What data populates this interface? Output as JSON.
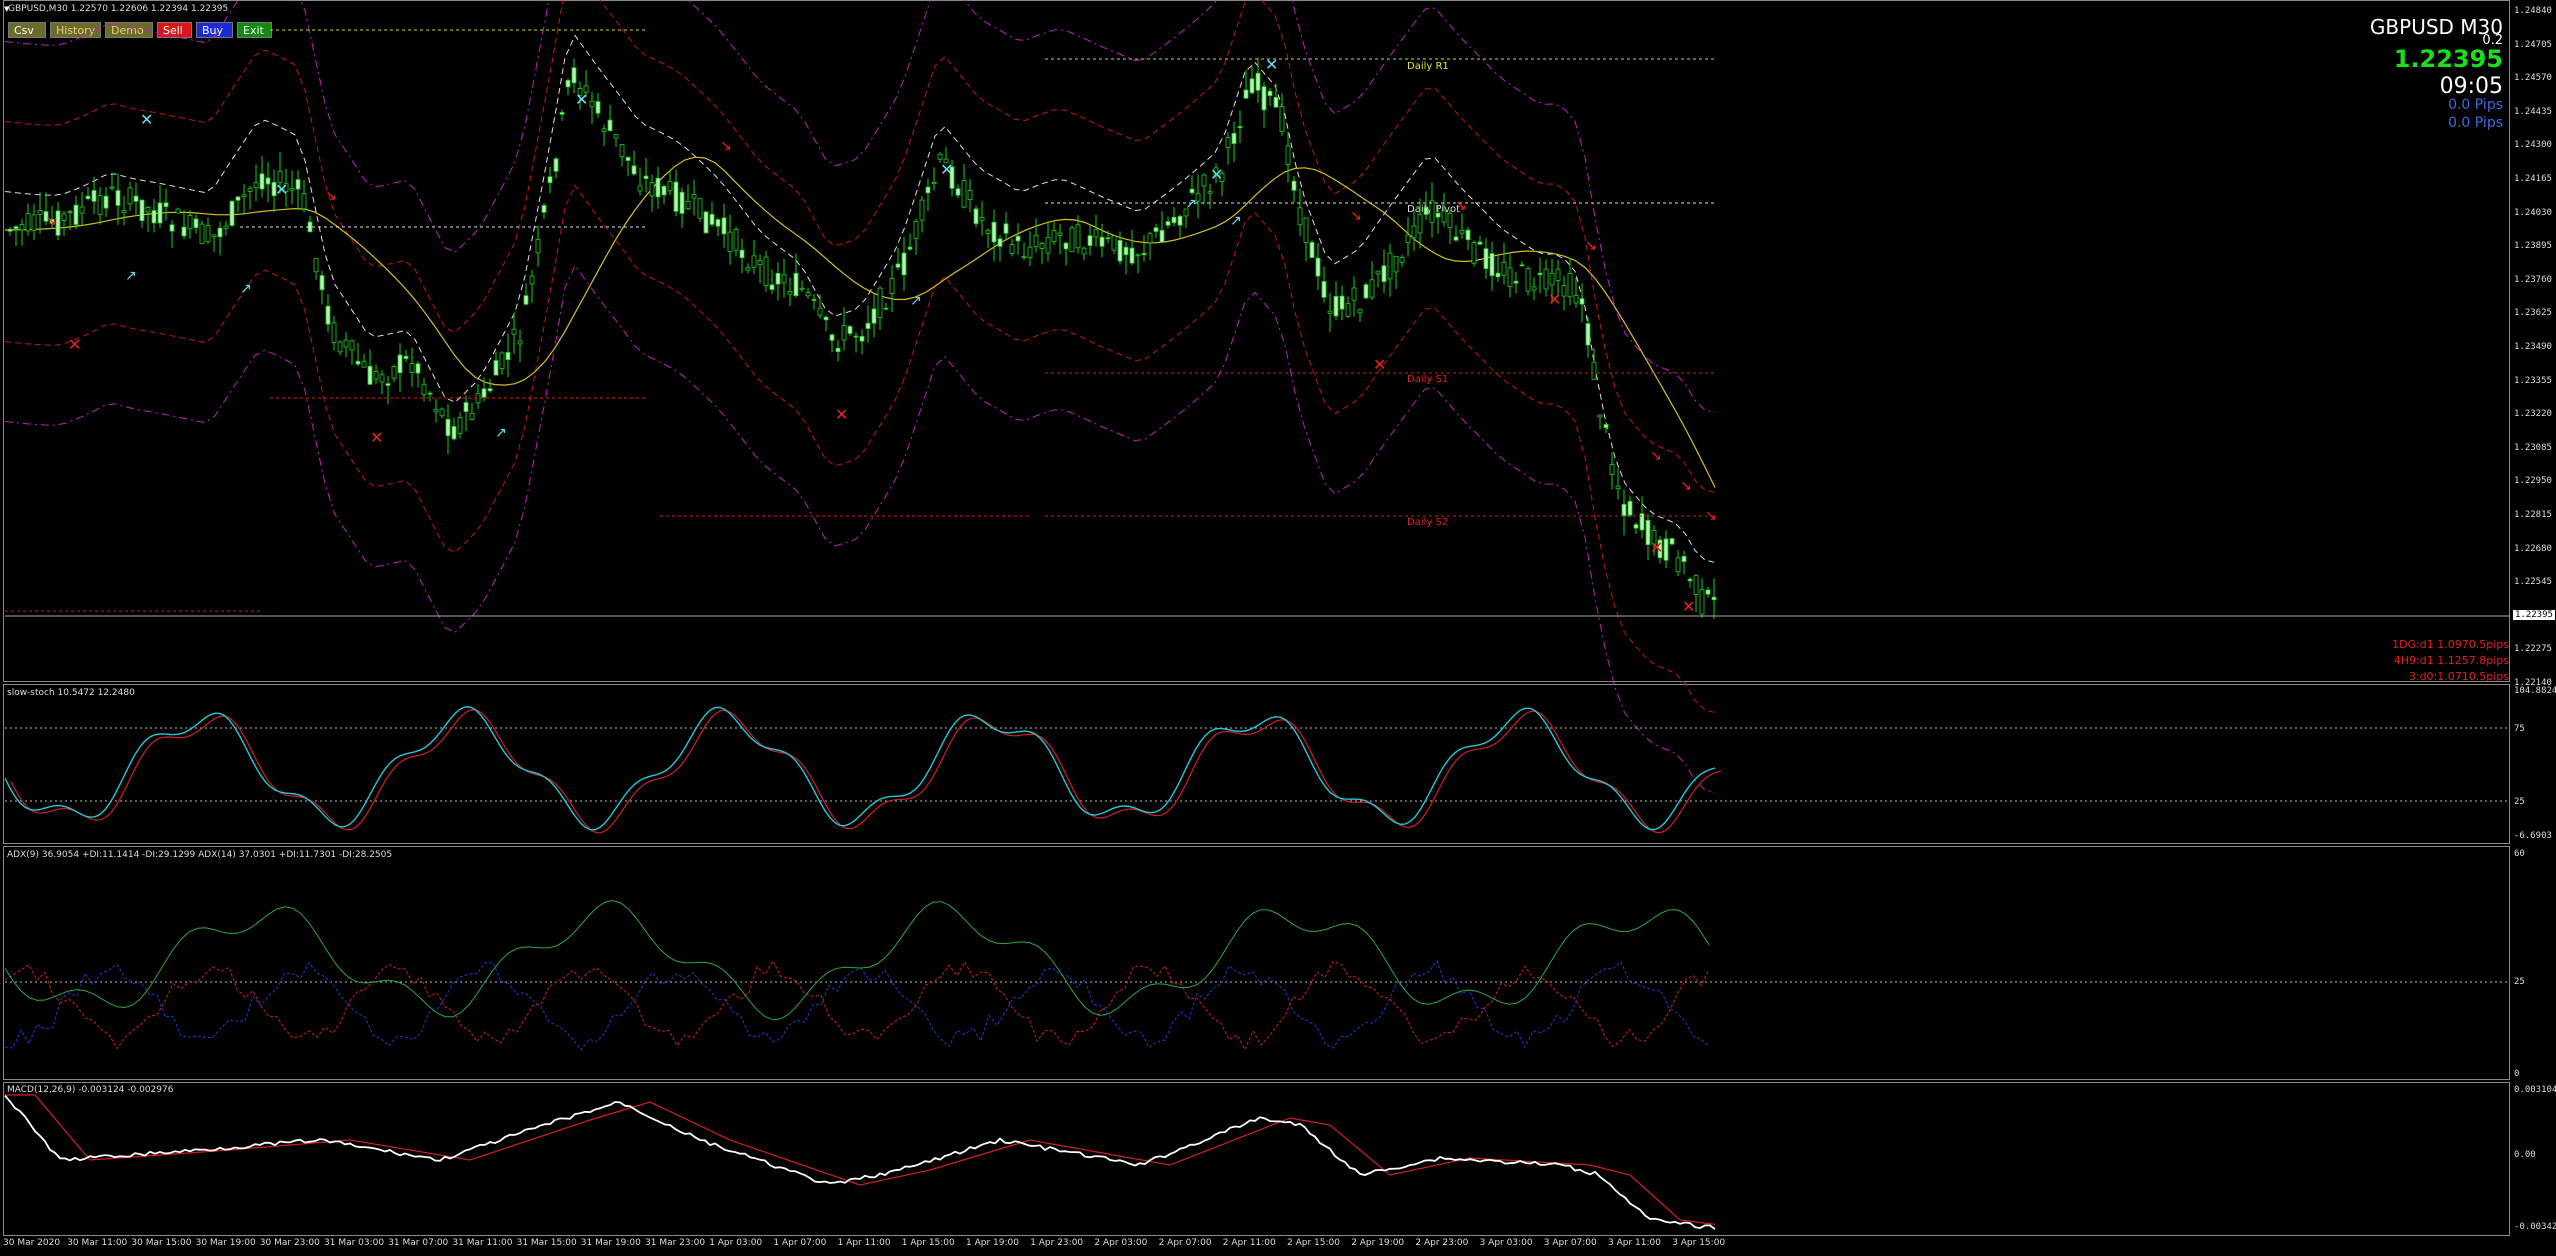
{
  "header": {
    "title": "GBPUSD,M30  1.22570 1.22606 1.22394 1.22395"
  },
  "toolbar": {
    "buttons": [
      {
        "label": "Csv",
        "bg": "#6b6b2a",
        "fg": "#ffffff"
      },
      {
        "label": "History",
        "bg": "#6b6b2a",
        "fg": "#e0d080"
      },
      {
        "label": "Demo",
        "bg": "#6b6b2a",
        "fg": "#e0d080"
      },
      {
        "label": "Sell",
        "bg": "#d81818",
        "fg": "#ffffff"
      },
      {
        "label": "Buy",
        "bg": "#1a2ad8",
        "fg": "#ffffff"
      },
      {
        "label": "Exit",
        "bg": "#128a12",
        "fg": "#ffffff"
      }
    ]
  },
  "hud": {
    "symbol": "GBPUSD M30",
    "spread": "0.2",
    "price": "1.22395",
    "time": "09:05",
    "pips1": "0.0 Pips",
    "pips2": "0.0 Pips",
    "colors": {
      "price": "#19e019",
      "pips": "#3a6adf",
      "symbol": "#ffffff"
    }
  },
  "levels": {
    "daily_r1": "Daily R1",
    "daily_pivot": "Daily Pivot",
    "daily_s1": "Daily S1",
    "daily_s2": "Daily S2"
  },
  "range_stats": [
    "1DG:d1 1.0970.5pips",
    "4H9:d1 1.1257.8pips",
    "3:d0:1.0710.5pips"
  ],
  "price_axis": {
    "ticks": [
      "1.24840",
      "1.24705",
      "1.24570",
      "1.24435",
      "1.24300",
      "1.24165",
      "1.24030",
      "1.23895",
      "1.23760",
      "1.23625",
      "1.23490",
      "1.23355",
      "1.23220",
      "1.23085",
      "1.22950",
      "1.22815",
      "1.22680",
      "1.22545",
      "1.22410",
      "1.22275",
      "1.22140"
    ],
    "current": "1.22395"
  },
  "stoch": {
    "label": "slow-stoch 10.5472 12.2480",
    "ticks": [
      "104.8824",
      "75",
      "25",
      "-6.6903"
    ]
  },
  "adx": {
    "label": "ADX(9) 36.9054 +DI:11.1414 -DI:29.1299  ADX(14) 37.0301 +DI:11.7301 -DI:28.2505",
    "ticks": [
      "60",
      "25",
      "0"
    ]
  },
  "macd": {
    "label": "MACD(12,26,9) -0.003124 -0.002976",
    "ticks": [
      "0.003104",
      "0.00",
      "-0.003421"
    ]
  },
  "time_axis": [
    "30 Mar 2020",
    "30 Mar 11:00",
    "30 Mar 15:00",
    "30 Mar 19:00",
    "30 Mar 23:00",
    "31 Mar 03:00",
    "31 Mar 07:00",
    "31 Mar 11:00",
    "31 Mar 15:00",
    "31 Mar 19:00",
    "31 Mar 23:00",
    "1 Apr 03:00",
    "1 Apr 07:00",
    "1 Apr 11:00",
    "1 Apr 15:00",
    "1 Apr 19:00",
    "1 Apr 23:00",
    "2 Apr 03:00",
    "2 Apr 07:00",
    "2 Apr 11:00",
    "2 Apr 15:00",
    "2 Apr 19:00",
    "2 Apr 23:00",
    "3 Apr 03:00",
    "3 Apr 07:00",
    "3 Apr 11:00",
    "3 Apr 15:00"
  ],
  "icons": [
    "buy-arrow-icon",
    "sell-arrow-icon",
    "cross-icon"
  ]
}
